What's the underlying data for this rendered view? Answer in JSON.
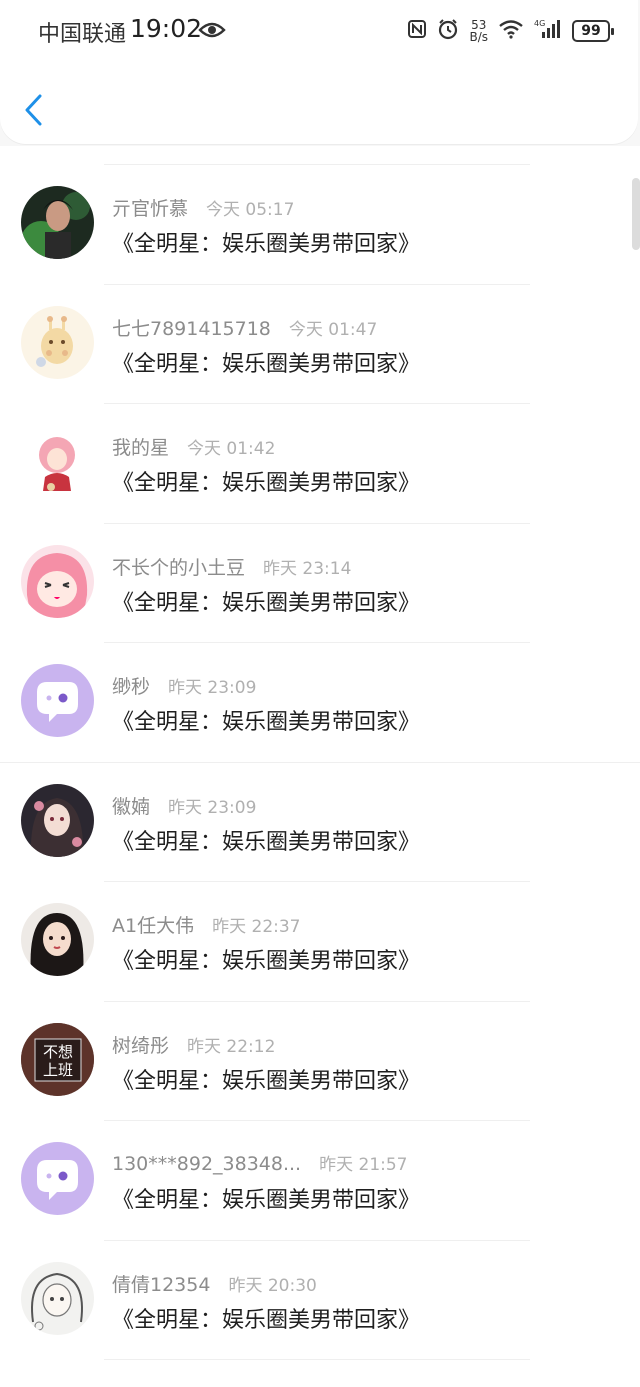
{
  "status_bar": {
    "carrier": "中国联通",
    "time": "19:02",
    "net_speed_top": "53",
    "net_speed_bottom": "B/s",
    "battery": "99"
  },
  "comments": [
    {
      "user": "亓官忻慕",
      "time": "今天 05:17",
      "text": "《全明星：娱乐圈美男带回家》",
      "avatar": "photo-dark"
    },
    {
      "user": "七七7891415718",
      "time": "今天 01:47",
      "text": "《全明星：娱乐圈美男带回家》",
      "avatar": "giraffe"
    },
    {
      "user": "我的星",
      "time": "今天 01:42",
      "text": "《全明星：娱乐圈美男带回家》",
      "avatar": "anime-pink-small"
    },
    {
      "user": "不长个的小土豆",
      "time": "昨天 23:14",
      "text": "《全明星：娱乐圈美男带回家》",
      "avatar": "anime-pink"
    },
    {
      "user": "缈秒",
      "time": "昨天 23:09",
      "text": "《全明星：娱乐圈美男带回家》",
      "avatar": "default-chat"
    },
    {
      "user": "徽婻",
      "time": "昨天 23:09",
      "text": "《全明星：娱乐圈美男带回家》",
      "avatar": "anime-girl-dark"
    },
    {
      "user": "A1任大伟",
      "time": "昨天 22:37",
      "text": "《全明星：娱乐圈美男带回家》",
      "avatar": "girl-portrait"
    },
    {
      "user": "树绮彤",
      "time": "昨天 22:12",
      "text": "《全明星：娱乐圈美男带回家》",
      "avatar": "text-image",
      "avatar_text": [
        "不想",
        "上班"
      ]
    },
    {
      "user": "130***892_38348...",
      "time": "昨天 21:57",
      "text": "《全明星：娱乐圈美男带回家》",
      "avatar": "default-chat"
    },
    {
      "user": "倩倩12354",
      "time": "昨天 20:30",
      "text": "《全明星：娱乐圈美男带回家》",
      "avatar": "sketch-girl"
    }
  ],
  "colors": {
    "accent": "#1e90e8",
    "default_avatar_bg": "#c9b4ef"
  }
}
